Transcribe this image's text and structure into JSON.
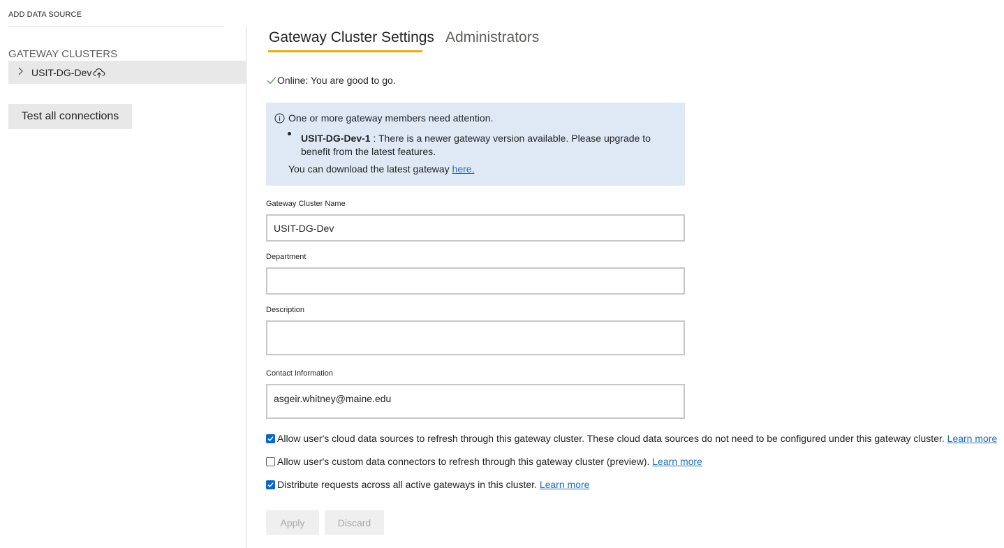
{
  "sidebar": {
    "add_data_source": "ADD DATA SOURCE",
    "section_title": "GATEWAY CLUSTERS",
    "clusters": [
      {
        "name": "USIT-DG-Dev",
        "icon": "cloud-upload-icon"
      }
    ],
    "test_button": "Test all connections"
  },
  "tabs": [
    {
      "label": "Gateway Cluster Settings",
      "active": true
    },
    {
      "label": "Administrators",
      "active": false
    }
  ],
  "status": {
    "icon": "checkmark-icon",
    "text": "Online: You are good to go."
  },
  "alert": {
    "icon": "info-icon",
    "heading": "One or more gateway members need attention.",
    "member": "USIT-DG-Dev-1",
    "message": " : There is a newer gateway version available. Please upgrade to benefit from the latest features.",
    "download_text": "You can download the latest gateway ",
    "download_link": "here."
  },
  "form": {
    "cluster_name_label": "Gateway Cluster Name",
    "cluster_name_value": "USIT-DG-Dev",
    "department_label": "Department",
    "department_value": "",
    "description_label": "Description",
    "description_value": "",
    "contact_label": "Contact Information",
    "contact_value": "asgeir.whitney@maine.edu"
  },
  "options": [
    {
      "checked": true,
      "text": "Allow user's cloud data sources to refresh through this gateway cluster. These cloud data sources do not need to be configured under this gateway cluster. ",
      "link": "Learn more"
    },
    {
      "checked": false,
      "text": "Allow user's custom data connectors to refresh through this gateway cluster (preview). ",
      "link": "Learn more"
    },
    {
      "checked": true,
      "text": "Distribute requests across all active gateways in this cluster. ",
      "link": "Learn more"
    }
  ],
  "actions": {
    "apply": "Apply",
    "discard": "Discard"
  },
  "colors": {
    "accent_underline": "#e8b100",
    "checkbox": "#0a67c4",
    "link": "#1d6fb8",
    "alert_bg": "#dfe9f5"
  }
}
